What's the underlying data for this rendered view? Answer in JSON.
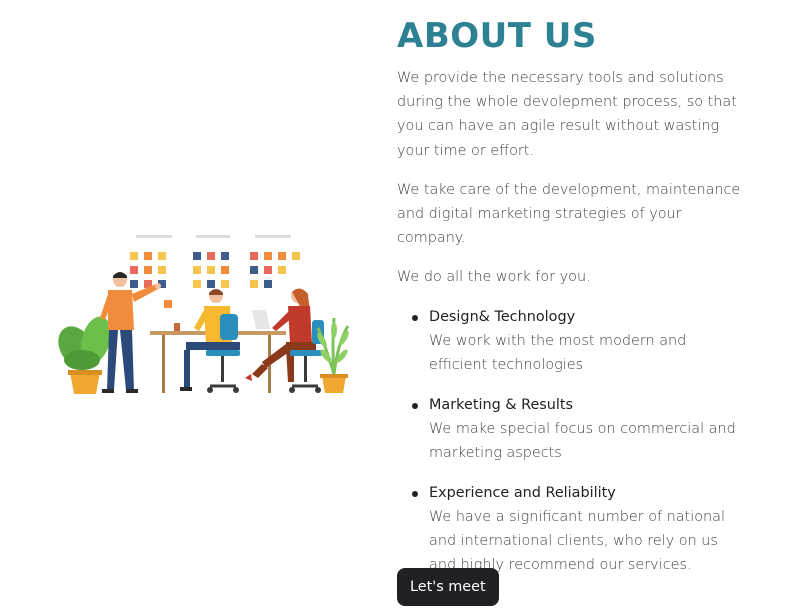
{
  "about": {
    "title": "ABOUT US",
    "paragraphs": [
      "We provide the necessary tools and solutions during the whole devolepment process, so that you can have an agile result without wasting your time or effort.",
      "We take care of the development, maintenance and digital marketing strategies of your company.",
      "We do all the work for you."
    ],
    "features": [
      {
        "title": "Design& Technology",
        "description": "We work with the most modern and efficient technologies"
      },
      {
        "title": "Marketing & Results",
        "description": "We make special focus on commercial and marketing aspects"
      },
      {
        "title": "Experience and Reliability",
        "description": "We have a significant number of national and international clients, who rely on us and highly recommend our services."
      }
    ],
    "cta_label": "Let's meet"
  },
  "colors": {
    "title": "#2e8193",
    "button_bg": "#202124",
    "button_text": "#ffffff",
    "body_text": "#444444"
  },
  "illustration": {
    "icon": "team-collaboration-illustration"
  }
}
